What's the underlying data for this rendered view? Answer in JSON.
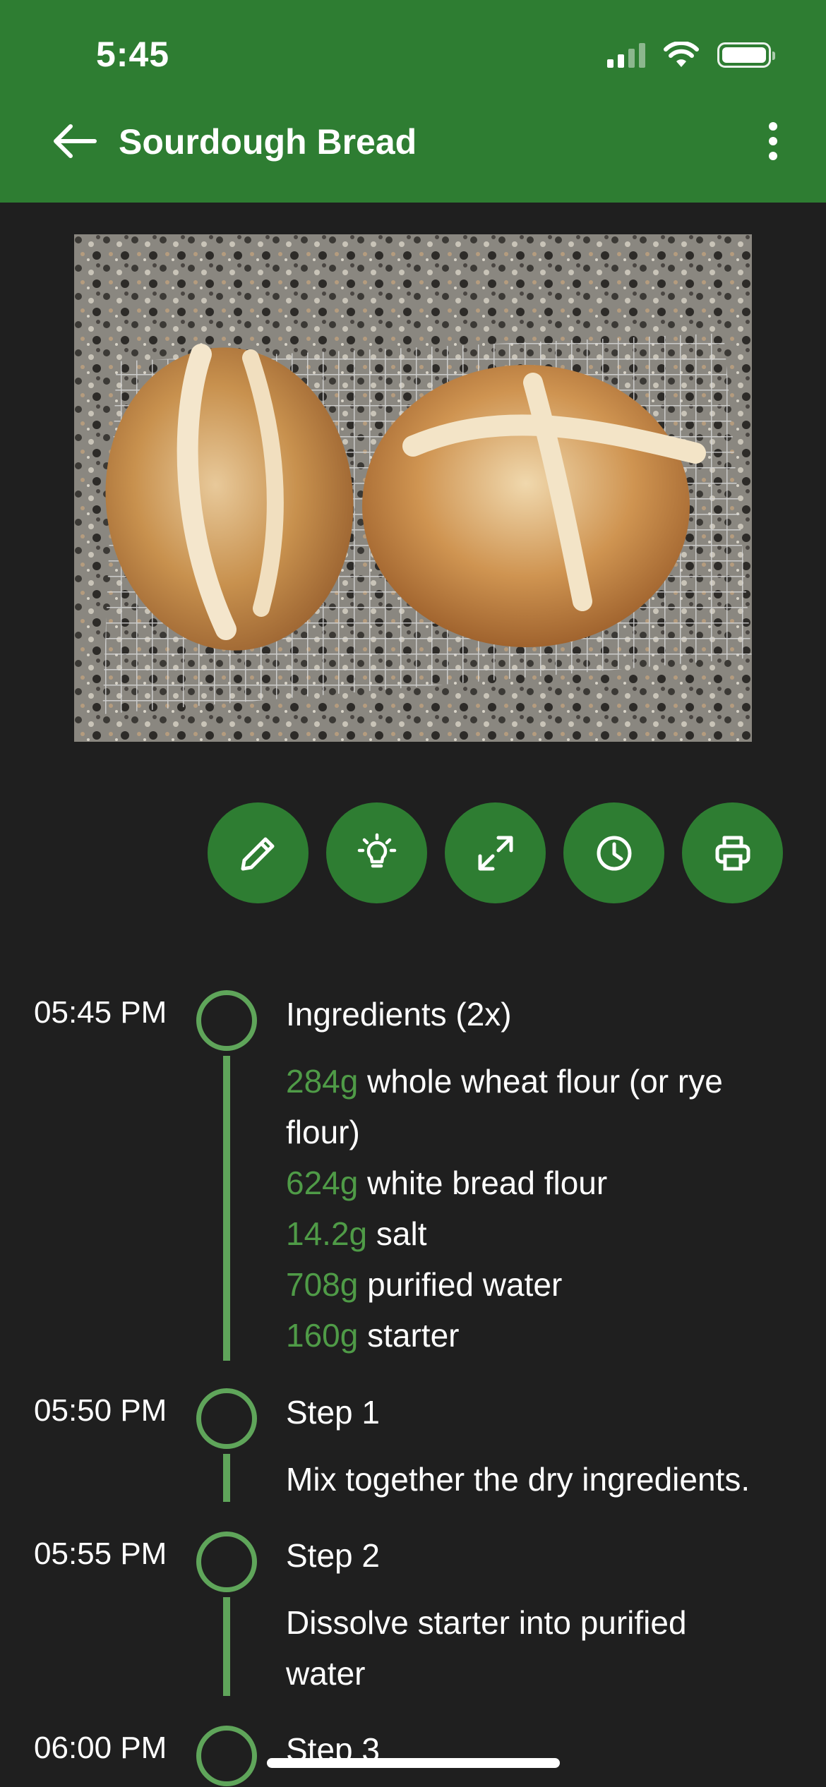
{
  "status_bar": {
    "time": "5:45"
  },
  "header": {
    "title": "Sourdough Bread",
    "back_icon": "arrow-left-icon",
    "menu_icon": "more-vert-icon"
  },
  "photo": {
    "alt": "Two loaves of sourdough bread on a cooling rack"
  },
  "actions": [
    {
      "icon": "pencil-icon",
      "name": "edit-button"
    },
    {
      "icon": "lightbulb-icon",
      "name": "tips-button"
    },
    {
      "icon": "expand-icon",
      "name": "fullscreen-button"
    },
    {
      "icon": "clock-icon",
      "name": "timer-button"
    },
    {
      "icon": "printer-icon",
      "name": "print-button"
    }
  ],
  "timeline": [
    {
      "time": "05:45 PM",
      "title": "Ingredients (2x)",
      "ingredients": [
        {
          "qty": "284g",
          "text": "whole wheat flour (or rye flour)"
        },
        {
          "qty": "624g",
          "text": "white bread flour"
        },
        {
          "qty": "14.2g",
          "text": "salt"
        },
        {
          "qty": "708g",
          "text": "purified water"
        },
        {
          "qty": "160g",
          "text": "starter"
        }
      ]
    },
    {
      "time": "05:50 PM",
      "title": "Step 1",
      "body": "Mix together the dry ingredients."
    },
    {
      "time": "05:55 PM",
      "title": "Step 2",
      "body": "Dissolve starter into purified water"
    },
    {
      "time": "06:00 PM",
      "title": "Step 3",
      "body": ""
    }
  ],
  "colors": {
    "appbar": "#2e7d32",
    "accent": "#5fa55a",
    "quantity": "#4f9b47",
    "background": "#1f1f1f"
  }
}
